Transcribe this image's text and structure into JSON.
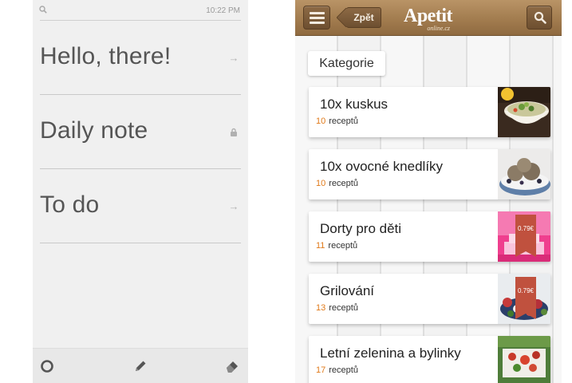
{
  "notes_app": {
    "status_time": "10:22 PM",
    "search_icon": "search-icon",
    "notes": [
      {
        "title": "Hello, there!",
        "icon": "arrow-right-icon"
      },
      {
        "title": "Daily note",
        "icon": "lock-icon"
      },
      {
        "title": "To do",
        "icon": "arrow-right-icon"
      }
    ],
    "toolbar": {
      "icons": [
        "circle-icon",
        "pencil-icon",
        "eraser-icon"
      ]
    },
    "colors": {
      "background": "#f0f0f0",
      "text": "#555555",
      "divider": "#c9c9c9"
    }
  },
  "apetit_app": {
    "header": {
      "back_label": "Zpět",
      "logo_text": "Apetit",
      "logo_subtext": "online.cz"
    },
    "section_label": "Kategorie",
    "recipe_word": "receptů",
    "categories": [
      {
        "title": "10x kuskus",
        "count": "10",
        "thumb": "couscous-bowl-image"
      },
      {
        "title": "10x ovocné knedlíky",
        "count": "10",
        "thumb": "fruit-dumplings-image"
      },
      {
        "title": "Dorty pro děti",
        "count": "11",
        "thumb": "kids-cakes-image",
        "price": "0.79€"
      },
      {
        "title": "Grilování",
        "count": "13",
        "thumb": "grilling-image",
        "price": "0.79€"
      },
      {
        "title": "Letní zelenina a bylinky",
        "count": "17",
        "thumb": "summer-vegetables-image"
      }
    ],
    "colors": {
      "header": "#a27c4f",
      "count_accent": "#e07a1a",
      "price_tag": "#c0513e"
    }
  }
}
